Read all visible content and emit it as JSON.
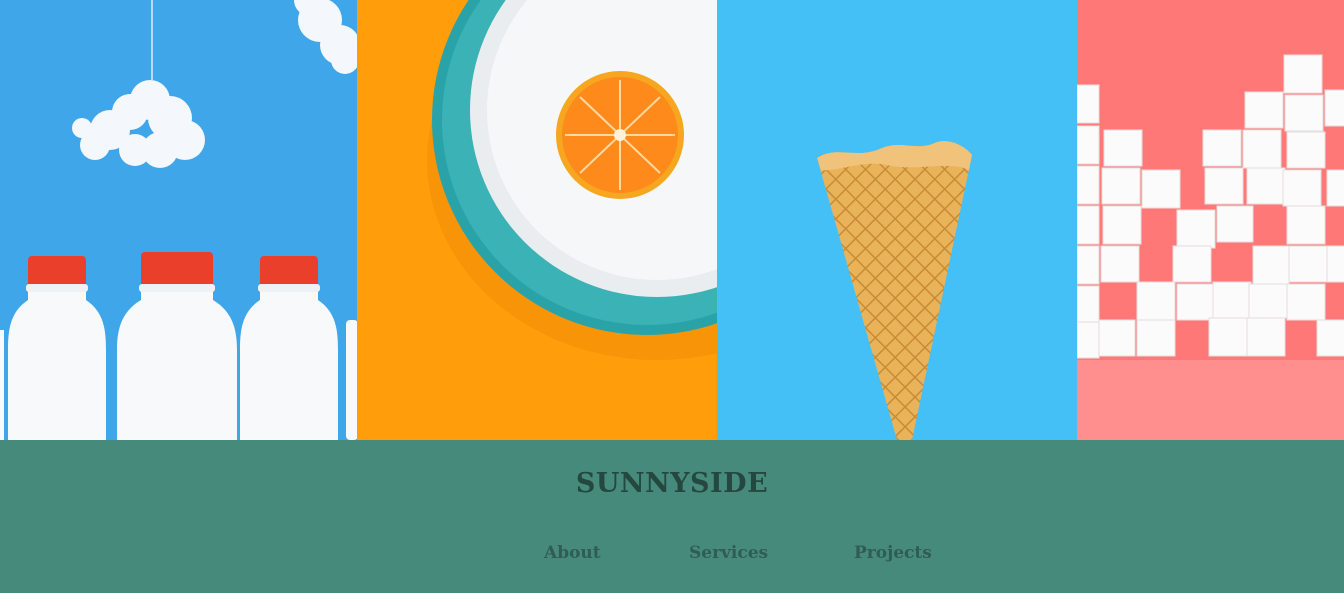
{
  "gallery": {
    "images": [
      {
        "subject": "milk-bottles-with-cloud",
        "background": "#3fa6ea"
      },
      {
        "subject": "orange-slice-on-plate",
        "background": "#ff9d0a"
      },
      {
        "subject": "ice-cream-cone",
        "background": "#45c0f7"
      },
      {
        "subject": "sugar-cubes",
        "background": "#ff7878"
      }
    ]
  },
  "footer": {
    "brand": "sunnyside",
    "nav": {
      "about": "About",
      "services": "Services",
      "projects": "Projects"
    },
    "background": "#468a7b"
  }
}
